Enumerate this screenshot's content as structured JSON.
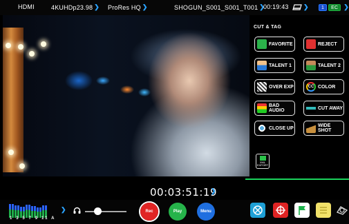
{
  "topbar": {
    "input": "HDMI",
    "format": "4KUHDp23.98",
    "codec": "ProRes HQ",
    "clip": "SHOGUN_S001_S001_T001",
    "time": "00:19:43",
    "badge1": "1",
    "badge2": "EC"
  },
  "panel": {
    "title": "CUT & TAG",
    "buttons": [
      {
        "label": "FAVORITE"
      },
      {
        "label": "REJECT"
      },
      {
        "label": "TALENT 1"
      },
      {
        "label": "TALENT 2"
      },
      {
        "label": "OVER EXP"
      },
      {
        "label": "COLOR"
      },
      {
        "label": "BAD AUDIO"
      },
      {
        "label": "CUT AWAY"
      },
      {
        "label": "CLOSE UP"
      },
      {
        "label": "WIDE SHOT"
      }
    ],
    "export_label": "XML\nEXPORT"
  },
  "timecode": "00:03:51:19",
  "audio": {
    "channel_labels": "1 3 5 7 9 11 A"
  },
  "transport": {
    "rec": "Rec",
    "play": "Play",
    "menu": "Menu"
  },
  "colors": {
    "accent": "#2aa3ff",
    "rec": "#e02424",
    "play": "#26b34a",
    "menu": "#1f6fe0",
    "green_line": "#1bd45c"
  }
}
